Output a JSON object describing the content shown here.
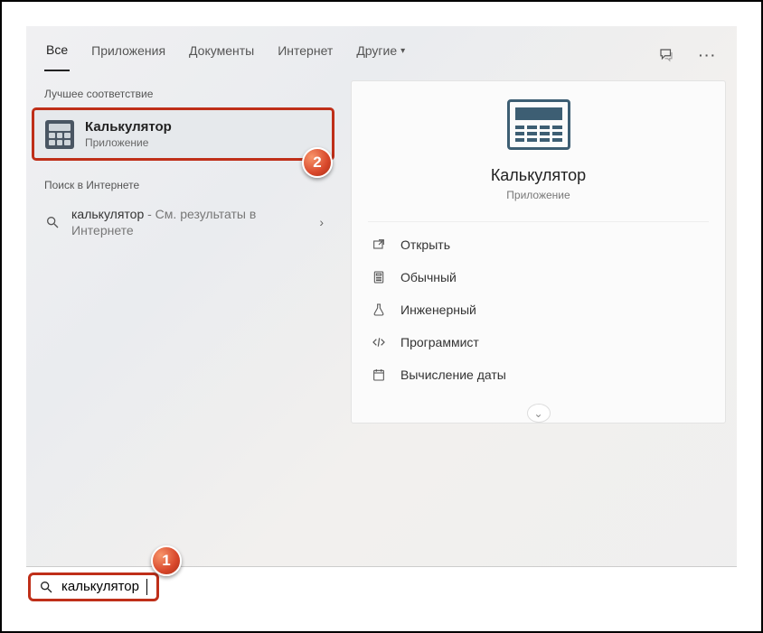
{
  "tabs": {
    "all": "Все",
    "apps": "Приложения",
    "docs": "Документы",
    "web": "Интернет",
    "more": "Другие"
  },
  "sections": {
    "bestMatch": "Лучшее соответствие",
    "webSearch": "Поиск в Интернете"
  },
  "bestMatch": {
    "title": "Калькулятор",
    "subtitle": "Приложение"
  },
  "webResult": {
    "query": "калькулятор",
    "suffix": " - См. результаты в Интернете"
  },
  "preview": {
    "title": "Калькулятор",
    "subtitle": "Приложение",
    "actions": {
      "open": "Открыть",
      "standard": "Обычный",
      "scientific": "Инженерный",
      "programmer": "Программист",
      "datecalc": "Вычисление даты"
    }
  },
  "search": {
    "value": "калькулятор"
  },
  "annotations": {
    "one": "1",
    "two": "2"
  }
}
